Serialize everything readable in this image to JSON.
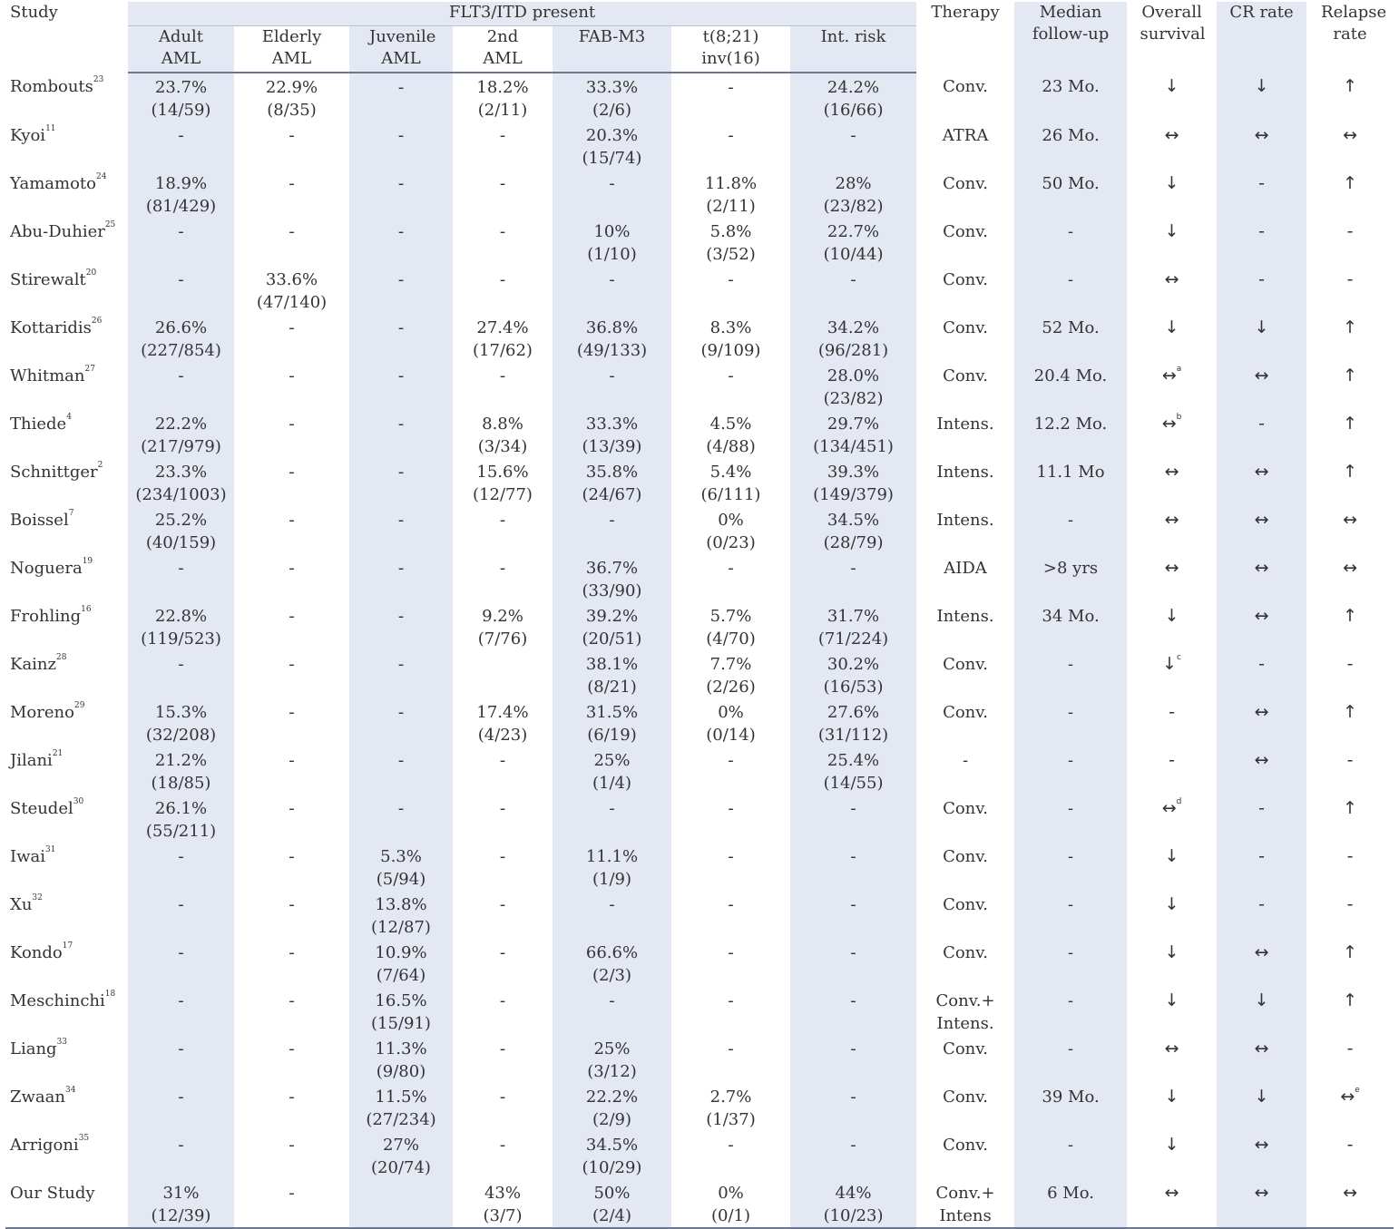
{
  "header": {
    "study": "Study",
    "group": "FLT3/ITD present",
    "subcols": [
      "Adult AML",
      "Elderly AML",
      "Juvenile AML",
      "2nd AML",
      "FAB-M3",
      "t(8;21) inv(16)",
      "Int. risk"
    ],
    "therapy": "Therapy",
    "median_followup": "Median follow-up",
    "overall_survival": "Overall survival",
    "cr_rate": "CR rate",
    "relapse_rate": "Relapse rate"
  },
  "rows": [
    {
      "study": "Rombouts",
      "ref": "23",
      "cells": [
        "23.7%\n(14/59)",
        "22.9%\n(8/35)",
        "-",
        "18.2%\n(2/11)",
        "33.3%\n(2/6)",
        "-",
        "24.2%\n(16/66)"
      ],
      "therapy": "Conv.",
      "followup": "23 Mo.",
      "os": "↓",
      "cr": "↓",
      "relapse": "↑"
    },
    {
      "study": "Kyoi",
      "ref": "11",
      "cells": [
        "-",
        "-",
        "-",
        "-",
        "20.3%\n(15/74)",
        "-",
        "-"
      ],
      "therapy": "ATRA",
      "followup": "26 Mo.",
      "os": "↔",
      "cr": "↔",
      "relapse": "↔"
    },
    {
      "study": "Yamamoto",
      "ref": "24",
      "cells": [
        "18.9%\n(81/429)",
        "-",
        "-",
        "-",
        "-",
        "11.8%\n(2/11)",
        "28%\n(23/82)"
      ],
      "therapy": "Conv.",
      "followup": "50 Mo.",
      "os": "↓",
      "cr": "-",
      "relapse": "↑"
    },
    {
      "study": "Abu-Duhier",
      "ref": "25",
      "cells": [
        "-",
        "-",
        "-",
        "-",
        "10%\n(1/10)",
        "5.8%\n(3/52)",
        "22.7%\n(10/44)"
      ],
      "therapy": "Conv.",
      "followup": "-",
      "os": "↓",
      "cr": "-",
      "relapse": "-"
    },
    {
      "study": "Stirewalt",
      "ref": "20",
      "cells": [
        "-",
        "33.6%\n(47/140)",
        "-",
        "-",
        "-",
        "-",
        "-"
      ],
      "therapy": "Conv.",
      "followup": "-",
      "os": "↔",
      "cr": "-",
      "relapse": "-"
    },
    {
      "study": "Kottaridis",
      "ref": "26",
      "cells": [
        "26.6%\n(227/854)",
        "-",
        "-",
        "27.4%\n(17/62)",
        "36.8%\n(49/133)",
        "8.3%\n(9/109)",
        "34.2%\n(96/281)"
      ],
      "therapy": "Conv.",
      "followup": "52 Mo.",
      "os": "↓",
      "cr": "↓",
      "relapse": "↑"
    },
    {
      "study": "Whitman",
      "ref": "27",
      "cells": [
        "-",
        "-",
        "-",
        "-",
        "-",
        "-",
        "28.0%\n(23/82)"
      ],
      "therapy": "Conv.",
      "followup": "20.4 Mo.",
      "os": "↔",
      "os_sup": "a",
      "cr": "↔",
      "relapse": "↑"
    },
    {
      "study": "Thiede",
      "ref": "4",
      "cells": [
        "22.2%\n(217/979)",
        "-",
        "-",
        "8.8%\n(3/34)",
        "33.3%\n(13/39)",
        "4.5%\n(4/88)",
        "29.7%\n(134/451)"
      ],
      "therapy": "Intens.",
      "followup": "12.2 Mo.",
      "os": "↔",
      "os_sup": "b",
      "cr": "-",
      "relapse": "↑"
    },
    {
      "study": "Schnittger",
      "ref": "2",
      "cells": [
        "23.3%\n(234/1003)",
        "-",
        "-",
        "15.6%\n(12/77)",
        "35.8%\n(24/67)",
        "5.4%\n(6/111)",
        "39.3%\n(149/379)"
      ],
      "therapy": "Intens.",
      "followup": "11.1 Mo",
      "os": "↔",
      "cr": "↔",
      "relapse": "↑"
    },
    {
      "study": "Boissel",
      "ref": "7",
      "cells": [
        "25.2%\n(40/159)",
        "-",
        "-",
        "-",
        "-",
        "0%\n(0/23)",
        "34.5%\n(28/79)"
      ],
      "therapy": "Intens.",
      "followup": "-",
      "os": "↔",
      "cr": "↔",
      "relapse": "↔"
    },
    {
      "study": "Noguera",
      "ref": "19",
      "cells": [
        "-",
        "-",
        "-",
        "-",
        "36.7%\n(33/90)",
        "-",
        "-"
      ],
      "therapy": "AIDA",
      "followup": ">8 yrs",
      "os": "↔",
      "cr": "↔",
      "relapse": "↔"
    },
    {
      "study": "Frohling",
      "ref": "16",
      "cells": [
        "22.8%\n(119/523)",
        "-",
        "-",
        "9.2%\n(7/76)",
        "39.2%\n(20/51)",
        "5.7%\n(4/70)",
        "31.7%\n(71/224)"
      ],
      "therapy": "Intens.",
      "followup": "34 Mo.",
      "os": "↓",
      "cr": "↔",
      "relapse": "↑"
    },
    {
      "study": "Kainz",
      "ref": "28",
      "cells": [
        "-",
        "-",
        "-",
        "",
        "38.1%\n(8/21)",
        "7.7%\n(2/26)",
        "30.2%\n(16/53)"
      ],
      "therapy": "Conv.",
      "followup": "-",
      "os": "↓",
      "os_sup": "c",
      "cr": "-",
      "relapse": "-"
    },
    {
      "study": "Moreno",
      "ref": "29",
      "cells": [
        "15.3%\n(32/208)",
        "-",
        "-",
        "17.4%\n(4/23)",
        "31.5%\n(6/19)",
        "0%\n(0/14)",
        "27.6%\n(31/112)"
      ],
      "therapy": "Conv.",
      "followup": "-",
      "os": "-",
      "cr": "↔",
      "relapse": "↑"
    },
    {
      "study": "Jilani",
      "ref": "21",
      "cells": [
        "21.2%\n(18/85)",
        "-",
        "-",
        "-",
        "25%\n(1/4)",
        "-",
        "25.4%\n(14/55)"
      ],
      "therapy": "-",
      "followup": "-",
      "os": "-",
      "cr": "↔",
      "relapse": "-"
    },
    {
      "study": "Steudel",
      "ref": "30",
      "cells": [
        "26.1%\n(55/211)",
        "-",
        "-",
        "-",
        "-",
        "-",
        "-"
      ],
      "therapy": "Conv.",
      "followup": "-",
      "os": "↔",
      "os_sup": "d",
      "cr": "-",
      "relapse": "↑"
    },
    {
      "study": "Iwai",
      "ref": "31",
      "cells": [
        "-",
        "-",
        "5.3%\n(5/94)",
        "-",
        "11.1%\n(1/9)",
        "-",
        "-"
      ],
      "therapy": "Conv.",
      "followup": "-",
      "os": "↓",
      "cr": "-",
      "relapse": "-"
    },
    {
      "study": "Xu",
      "ref": "32",
      "cells": [
        "-",
        "-",
        "13.8%\n(12/87)",
        "-",
        "-",
        "-",
        "-"
      ],
      "therapy": "Conv.",
      "followup": "-",
      "os": "↓",
      "cr": "-",
      "relapse": "-"
    },
    {
      "study": "Kondo",
      "ref": "17",
      "cells": [
        "-",
        "-",
        "10.9%\n(7/64)",
        "-",
        "66.6%\n(2/3)",
        "-",
        "-"
      ],
      "therapy": "Conv.",
      "followup": "-",
      "os": "↓",
      "cr": "↔",
      "relapse": "↑"
    },
    {
      "study": "Meschinchi",
      "ref": "18",
      "cells": [
        "-",
        "-",
        "16.5%\n(15/91)",
        "-",
        "-",
        "-",
        "-"
      ],
      "therapy": "Conv.+\nIntens.",
      "followup": "-",
      "os": "↓",
      "cr": "↓",
      "relapse": "↑"
    },
    {
      "study": "Liang",
      "ref": "33",
      "cells": [
        "-",
        "-",
        "11.3%\n(9/80)",
        "-",
        "25%\n(3/12)",
        "-",
        "-"
      ],
      "therapy": "Conv.",
      "followup": "-",
      "os": "↔",
      "cr": "↔",
      "relapse": "-"
    },
    {
      "study": "Zwaan",
      "ref": "34",
      "cells": [
        "-",
        "-",
        "11.5%\n(27/234)",
        "-",
        "22.2%\n(2/9)",
        "2.7%\n(1/37)",
        "-"
      ],
      "therapy": "Conv.",
      "followup": "39 Mo.",
      "os": "↓",
      "cr": "↓",
      "relapse": "↔",
      "relapse_sup": "e"
    },
    {
      "study": "Arrigoni",
      "ref": "35",
      "cells": [
        "-",
        "-",
        "27%\n(20/74)",
        "-",
        "34.5%\n(10/29)",
        "-",
        "-"
      ],
      "therapy": "Conv.",
      "followup": "-",
      "os": "↓",
      "cr": "↔",
      "relapse": "-"
    },
    {
      "study": "Our Study",
      "ref": "",
      "cells": [
        "31%\n(12/39)",
        "-",
        "",
        "43%\n(3/7)",
        "50%\n(2/4)",
        "0%\n(0/1)",
        "44%\n(10/23)"
      ],
      "therapy": "Conv.+\nIntens",
      "followup": "6 Mo.",
      "os": "↔",
      "cr": "↔",
      "relapse": "↔"
    }
  ]
}
